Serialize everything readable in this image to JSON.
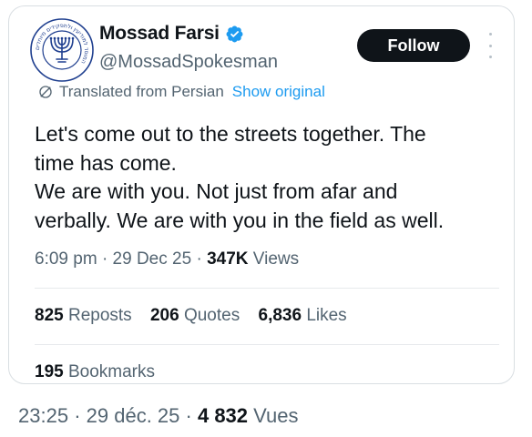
{
  "profile": {
    "display_name": "Mossad Farsi",
    "handle": "@MossadSpokesman",
    "verified": true,
    "avatar_icon": "seal-emblem-icon",
    "avatar_seal_text": "המוסד למודיעין ולתפקידים מיוחדים",
    "avatar_seal_motto": "באין תחבולות יפל עם"
  },
  "actions": {
    "follow_label": "Follow",
    "more_icon": "more-dots-icon"
  },
  "translation": {
    "icon": "globe-icon",
    "label": "Translated from Persian",
    "show_original_label": "Show original"
  },
  "tweet": {
    "lines": [
      "Let's come out to the streets together. The",
      "time has come.",
      "We are with you. Not just from afar and",
      "verbally. We are with you in the field as well."
    ]
  },
  "meta": {
    "time": "6:09 pm",
    "sep": "·",
    "date": "29 Dec 25",
    "views_count": "347K",
    "views_label": "Views"
  },
  "stats": {
    "reposts_count": "825",
    "reposts_label": "Reposts",
    "quotes_count": "206",
    "quotes_label": "Quotes",
    "likes_count": "6,836",
    "likes_label": "Likes",
    "bookmarks_count": "195",
    "bookmarks_label": "Bookmarks"
  },
  "outer_meta": {
    "time": "23:25",
    "sep": "·",
    "date": "29 déc. 25",
    "views_count": "4 832",
    "views_label": "Vues"
  },
  "colors": {
    "text_primary": "#0f1419",
    "text_secondary": "#536471",
    "accent": "#1d9bf0",
    "seal_blue": "#1f3f8f",
    "follow_bg": "#0f1419"
  }
}
